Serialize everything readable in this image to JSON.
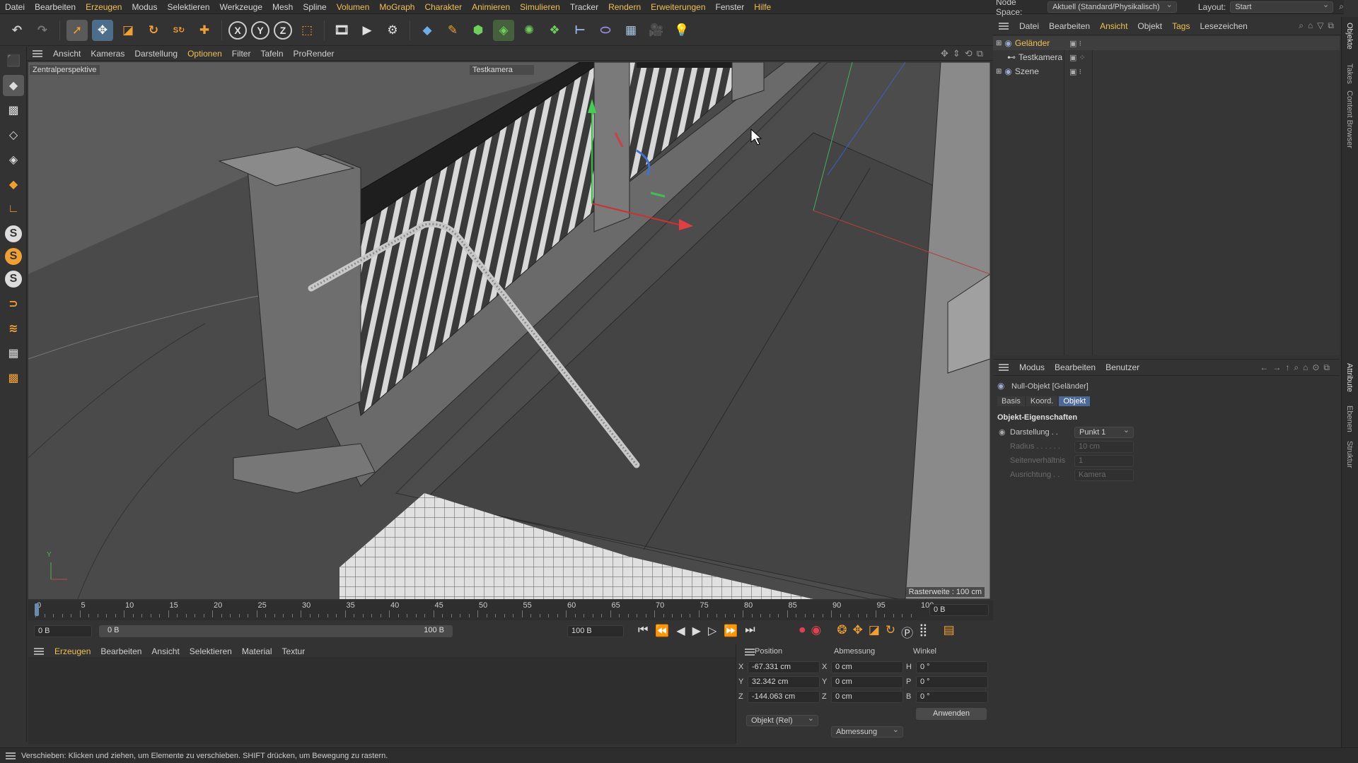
{
  "menubar": [
    "Datei",
    "Bearbeiten",
    "Erzeugen",
    "Modus",
    "Selektieren",
    "Werkzeuge",
    "Mesh",
    "Spline",
    "Volumen",
    "MoGraph",
    "Charakter",
    "Animieren",
    "Simulieren",
    "Tracker",
    "Rendern",
    "Erweiterungen",
    "Fenster",
    "Hilfe"
  ],
  "topright": {
    "nodespace_label": "Node Space:",
    "nodespace_value": "Aktuell (Standard/Physikalisch)",
    "layout_label": "Layout:",
    "layout_value": "Start"
  },
  "toolbar": {
    "axis_x": "X",
    "axis_y": "Y",
    "axis_z": "Z"
  },
  "lefttools": {
    "s1": "S",
    "s2": "S",
    "s3": "S"
  },
  "viewport": {
    "menu": [
      "Ansicht",
      "Kameras",
      "Darstellung",
      "Optionen",
      "Filter",
      "Tafeln",
      "ProRender"
    ],
    "perspective_label": "Zentralperspektive",
    "camera_label": "Testkamera",
    "grid_label": "Rasterweite : 100 cm",
    "axis_y": "Y",
    "axis_x": "X"
  },
  "timeline": {
    "ticks": [
      "0",
      "5",
      "10",
      "15",
      "20",
      "25",
      "30",
      "35",
      "40",
      "45",
      "50",
      "55",
      "60",
      "65",
      "70",
      "75",
      "80",
      "85",
      "90",
      "95",
      "100"
    ],
    "frame_display": "0 B",
    "start_field": "0 B",
    "range_start": "0 B",
    "range_end": "100 B",
    "end_field": "100 B"
  },
  "material": {
    "menu": [
      "Erzeugen",
      "Bearbeiten",
      "Ansicht",
      "Selektieren",
      "Material",
      "Textur"
    ]
  },
  "coords": {
    "headers": [
      "Position",
      "Abmessung",
      "Winkel"
    ],
    "rows": [
      {
        "axis": "X",
        "pos": "-67.331 cm",
        "dimaxis": "X",
        "dim": "0 cm",
        "angaxis": "H",
        "ang": "0 °"
      },
      {
        "axis": "Y",
        "pos": "32.342 cm",
        "dimaxis": "Y",
        "dim": "0 cm",
        "angaxis": "P",
        "ang": "0 °"
      },
      {
        "axis": "Z",
        "pos": "-144.063 cm",
        "dimaxis": "Z",
        "dim": "0 cm",
        "angaxis": "B",
        "ang": "0 °"
      }
    ],
    "mode": "Objekt (Rel)",
    "size_mode": "Abmessung",
    "apply": "Anwenden"
  },
  "objmanager": {
    "menu": [
      "Datei",
      "Bearbeiten",
      "Ansicht",
      "Objekt",
      "Tags",
      "Lesezeichen"
    ],
    "objects": [
      "Geländer",
      "Testkamera",
      "Szene"
    ]
  },
  "attributes": {
    "menu": [
      "Modus",
      "Bearbeiten",
      "Benutzer"
    ],
    "title": "Null-Objekt [Geländer]",
    "tabs": [
      "Basis",
      "Koord.",
      "Objekt"
    ],
    "section": "Objekt-Eigenschaften",
    "props": [
      {
        "label": "Darstellung . .",
        "value": "Punkt 1"
      },
      {
        "label": "Radius . . . . . .",
        "value": "10 cm"
      },
      {
        "label": "Seitenverhältnis",
        "value": "1"
      },
      {
        "label": "Ausrichtung . .",
        "value": "Kamera"
      }
    ]
  },
  "sidetabs": [
    "Objekte",
    "Takes",
    "Content Browser",
    "Attribute",
    "Ebenen",
    "Struktur"
  ],
  "status": "Verschieben: Klicken und ziehen, um Elemente zu verschieben. SHIFT drücken, um Bewegung zu rastern."
}
